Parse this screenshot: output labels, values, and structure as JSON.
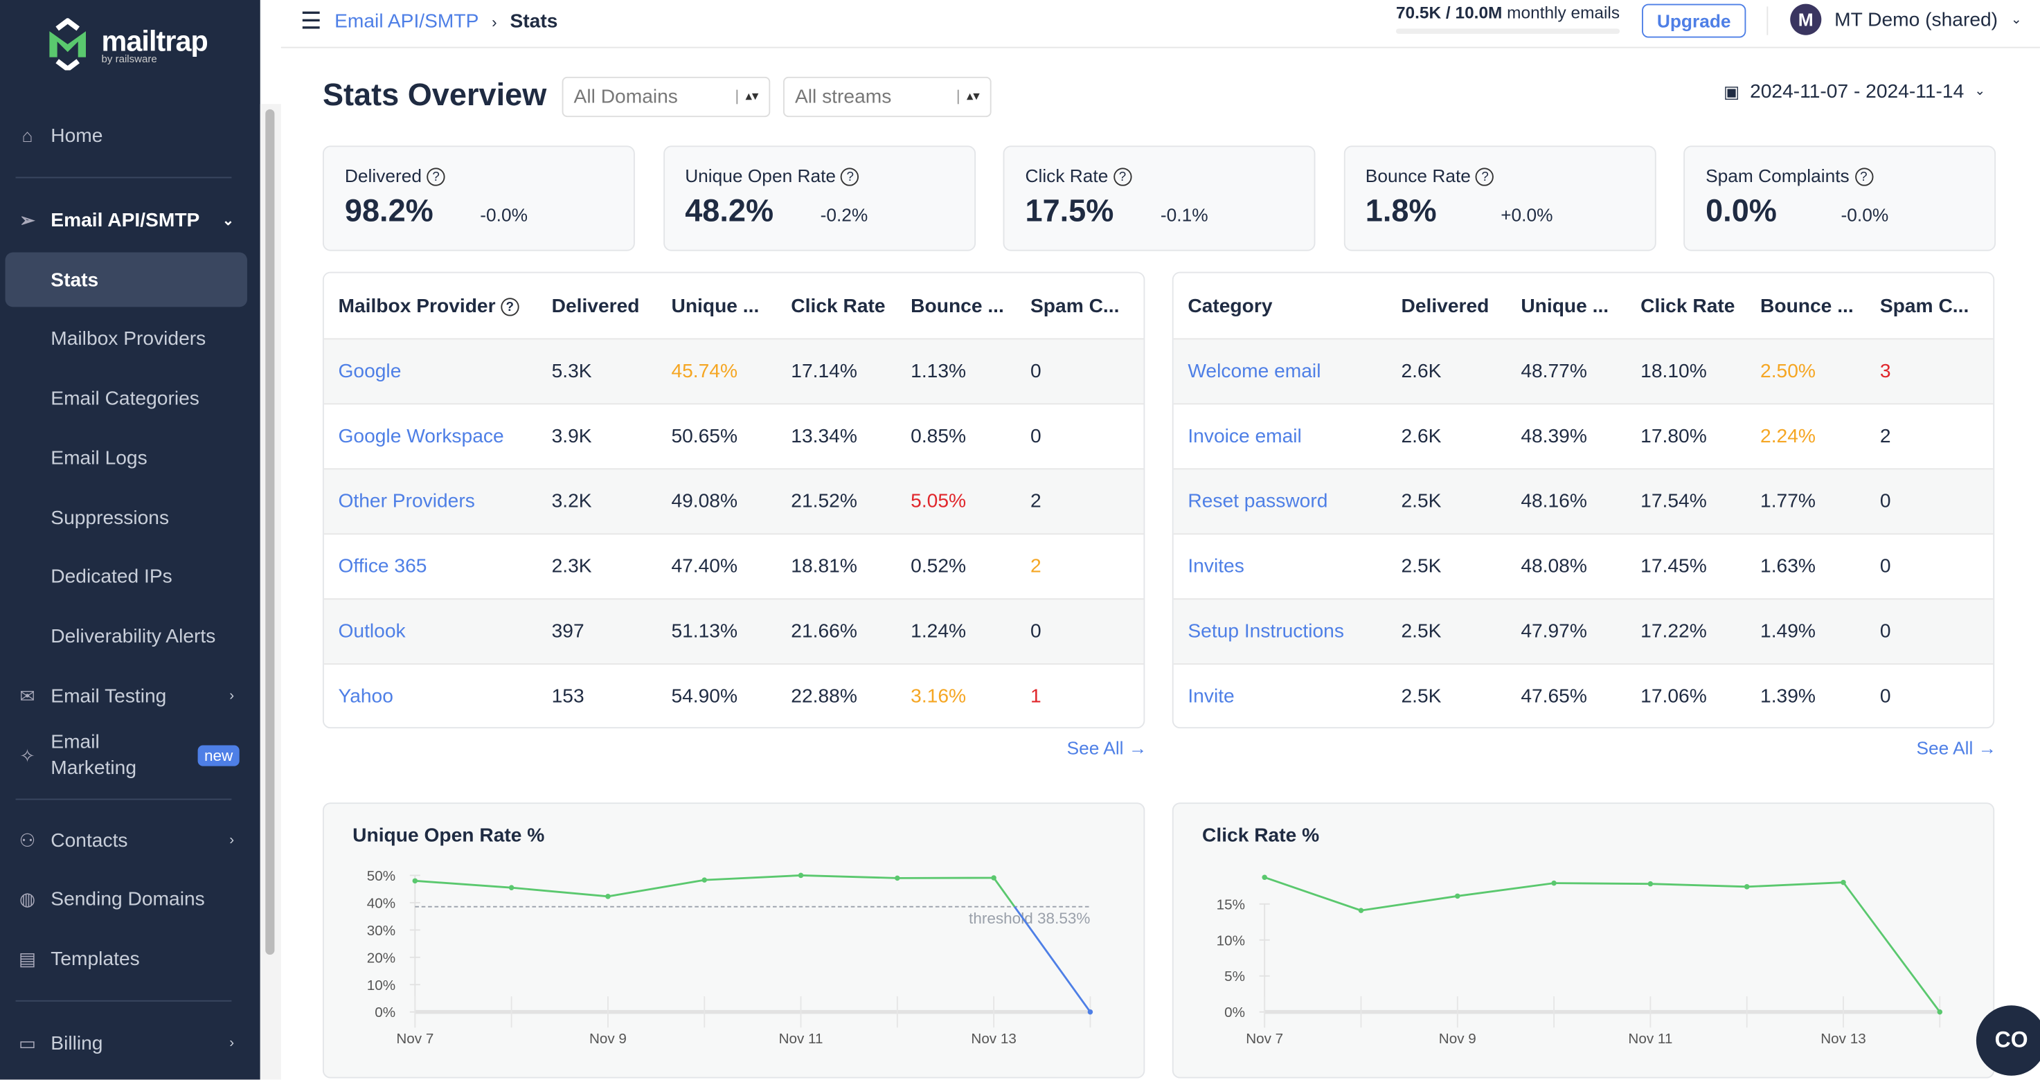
{
  "logo": {
    "name": "mailtrap",
    "by": "by railsware"
  },
  "sidebar": {
    "items": [
      {
        "label": "Home",
        "icon": "home-icon"
      },
      {
        "label": "Email API/SMTP",
        "icon": "send-icon"
      },
      {
        "label": "Stats"
      },
      {
        "label": "Mailbox Providers"
      },
      {
        "label": "Email Categories"
      },
      {
        "label": "Email Logs"
      },
      {
        "label": "Suppressions"
      },
      {
        "label": "Dedicated IPs"
      },
      {
        "label": "Deliverability Alerts"
      },
      {
        "label": "Email Testing",
        "icon": "envelope-check-icon"
      },
      {
        "label": "Email Marketing",
        "icon": "sparkle-icon",
        "badge": "new"
      },
      {
        "label": "Contacts",
        "icon": "contacts-icon"
      },
      {
        "label": "Sending Domains",
        "icon": "globe-icon"
      },
      {
        "label": "Templates",
        "icon": "template-icon"
      },
      {
        "label": "Billing",
        "icon": "card-icon"
      }
    ]
  },
  "topbar": {
    "breadcrumb": [
      "Email API/SMTP",
      "Stats"
    ],
    "usage_bold": "70.5K / 10.0M",
    "usage_text": "monthly emails",
    "usage_fraction": 0.00705,
    "upgrade": "Upgrade",
    "avatar": "M",
    "account": "MT Demo (shared)"
  },
  "page": {
    "title": "Stats Overview",
    "domain_filter": "All Domains",
    "stream_filter": "All streams",
    "date_range": "2024-11-07 - 2024-11-14"
  },
  "kpis": [
    {
      "label": "Delivered",
      "value": "98.2%",
      "delta": "-0.0%"
    },
    {
      "label": "Unique Open Rate",
      "value": "48.2%",
      "delta": "-0.2%"
    },
    {
      "label": "Click Rate",
      "value": "17.5%",
      "delta": "-0.1%"
    },
    {
      "label": "Bounce Rate",
      "value": "1.8%",
      "delta": "+0.0%"
    },
    {
      "label": "Spam Complaints",
      "value": "0.0%",
      "delta": "-0.0%"
    }
  ],
  "providers": {
    "headers": [
      "Mailbox Provider",
      "Delivered",
      "Unique ...",
      "Click Rate",
      "Bounce ...",
      "Spam C..."
    ],
    "rows": [
      [
        "Google",
        "5.3K",
        "45.74%",
        "17.14%",
        "1.13%",
        "0"
      ],
      [
        "Google Workspace",
        "3.9K",
        "50.65%",
        "13.34%",
        "0.85%",
        "0"
      ],
      [
        "Other Providers",
        "3.2K",
        "49.08%",
        "21.52%",
        "5.05%",
        "2"
      ],
      [
        "Office 365",
        "2.3K",
        "47.40%",
        "18.81%",
        "0.52%",
        "2"
      ],
      [
        "Outlook",
        "397",
        "51.13%",
        "21.66%",
        "1.24%",
        "0"
      ],
      [
        "Yahoo",
        "153",
        "54.90%",
        "22.88%",
        "3.16%",
        "1"
      ]
    ],
    "see_all": "See All →"
  },
  "categories": {
    "headers": [
      "Category",
      "Delivered",
      "Unique ...",
      "Click Rate",
      "Bounce ...",
      "Spam C..."
    ],
    "rows": [
      [
        "Welcome email",
        "2.6K",
        "48.77%",
        "18.10%",
        "2.50%",
        "3"
      ],
      [
        "Invoice email",
        "2.6K",
        "48.39%",
        "17.80%",
        "2.24%",
        "2"
      ],
      [
        "Reset password",
        "2.5K",
        "48.16%",
        "17.54%",
        "1.77%",
        "0"
      ],
      [
        "Invites",
        "2.5K",
        "48.08%",
        "17.45%",
        "1.63%",
        "0"
      ],
      [
        "Setup Instructions",
        "2.5K",
        "47.97%",
        "17.22%",
        "1.49%",
        "0"
      ],
      [
        "Invite",
        "2.5K",
        "47.65%",
        "17.06%",
        "1.39%",
        "0"
      ]
    ],
    "see_all": "See All →"
  },
  "colors": {
    "accent": "#4e7fe6",
    "warning": "#f5a623",
    "danger": "#e0262b",
    "line": "#5ac86e",
    "sidebar": "#1f2b42"
  },
  "chart_data": [
    {
      "type": "line",
      "title": "Unique Open Rate %",
      "x": [
        "Nov 7",
        "Nov 8",
        "Nov 9",
        "Nov 10",
        "Nov 11",
        "Nov 12",
        "Nov 13",
        "Nov 14"
      ],
      "xticks": [
        "Nov 7",
        "Nov 9",
        "Nov 11",
        "Nov 13"
      ],
      "values": [
        48,
        45.5,
        42.3,
        48.3,
        50,
        49,
        49.1,
        0
      ],
      "yticks": [
        "0%",
        "10%",
        "20%",
        "30%",
        "40%",
        "50%"
      ],
      "ylim": [
        0,
        50
      ],
      "threshold": 38.53,
      "threshold_label": "threshold 38.53%"
    },
    {
      "type": "line",
      "title": "Click Rate %",
      "x": [
        "Nov 7",
        "Nov 8",
        "Nov 9",
        "Nov 10",
        "Nov 11",
        "Nov 12",
        "Nov 13",
        "Nov 14"
      ],
      "xticks": [
        "Nov 7",
        "Nov 9",
        "Nov 11",
        "Nov 13"
      ],
      "values": [
        18.7,
        14.1,
        16.1,
        17.9,
        17.8,
        17.4,
        18.0,
        0
      ],
      "yticks": [
        "0%",
        "5%",
        "10%",
        "15%"
      ],
      "ylim": [
        0,
        15
      ]
    }
  ],
  "chat": {
    "label": "CO"
  }
}
